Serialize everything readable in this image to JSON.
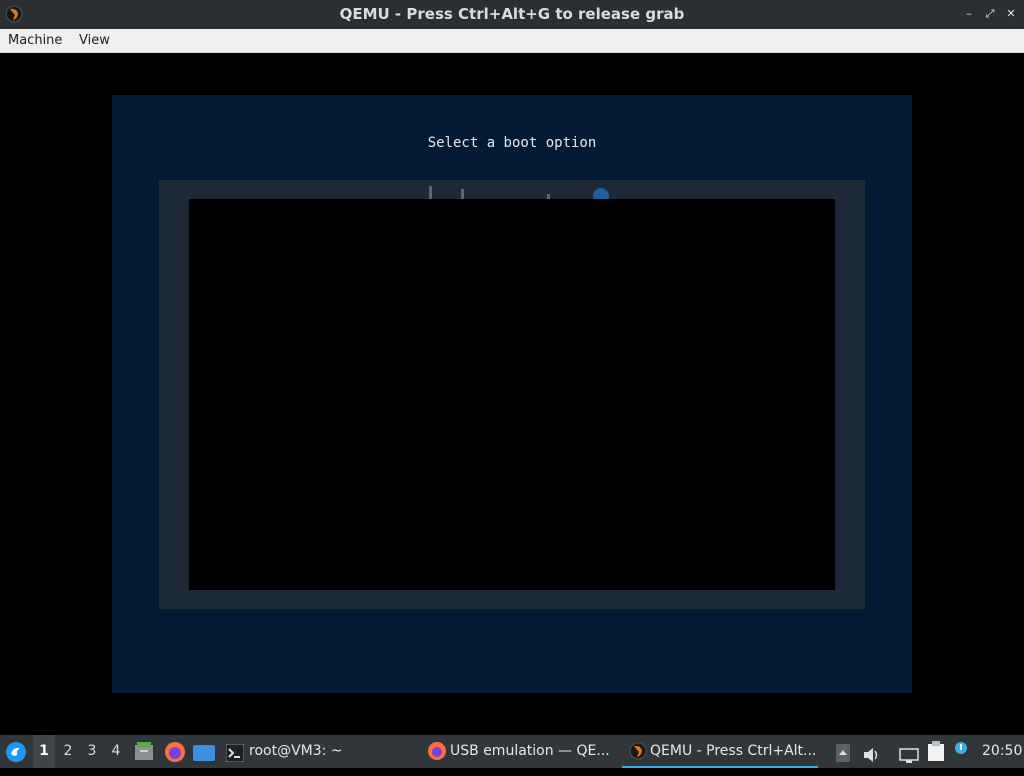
{
  "window": {
    "title": "QEMU - Press Ctrl+Alt+G to release grab",
    "controls": {
      "minimize": "–",
      "restore": "⤢",
      "close": "✕"
    }
  },
  "menu": {
    "items": [
      "Machine",
      "View"
    ]
  },
  "guest": {
    "boot_title": "Select a boot option"
  },
  "taskbar": {
    "desktops": [
      "1",
      "2",
      "3",
      "4"
    ],
    "active_desktop": "1",
    "tasks": [
      {
        "label": "root@VM3: ~",
        "icon": "terminal-icon"
      },
      {
        "label": "USB emulation — QE...",
        "icon": "firefox-icon"
      },
      {
        "label": "QEMU - Press Ctrl+Alt...",
        "icon": "qemu-icon"
      }
    ],
    "clock": "20:50"
  },
  "colors": {
    "titlebar": "#2b2e33",
    "menubar": "#efefef",
    "guest_panel": "#021a33",
    "guest_frame": "#1d2936",
    "taskbar": "#31363b",
    "accent": "#3daee9"
  }
}
